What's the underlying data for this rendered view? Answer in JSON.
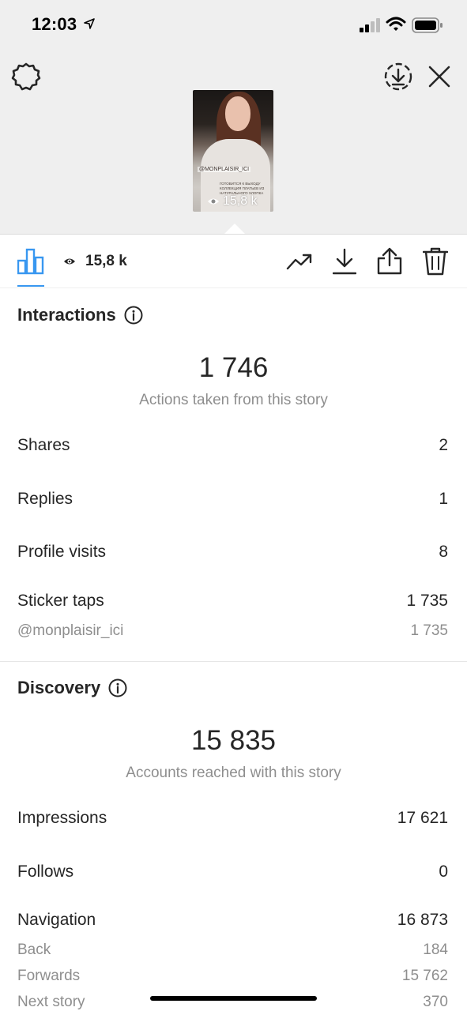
{
  "status_bar": {
    "time": "12:03"
  },
  "story_thumbnail": {
    "handle_text": "@MONPLAISIR_ICI",
    "caption_text": "ГОТОВИТСЯ К ВЫХОДУ КОЛЛЕКЦИЯ ПЛАТЬЕВ ИЗ НАТУРАЛЬНОГО ХЛОПКА",
    "views": "15,8 k"
  },
  "toolbar": {
    "views": "15,8 k"
  },
  "interactions": {
    "title": "Interactions",
    "total": "1 746",
    "caption": "Actions taken from this story",
    "rows": [
      {
        "label": "Shares",
        "value": "2"
      },
      {
        "label": "Replies",
        "value": "1"
      },
      {
        "label": "Profile visits",
        "value": "8"
      },
      {
        "label": "Sticker taps",
        "value": "1 735"
      }
    ],
    "sticker_sub": {
      "label": "@monplaisir_ici",
      "value": "1 735"
    }
  },
  "discovery": {
    "title": "Discovery",
    "total": "15 835",
    "caption": "Accounts reached with this story",
    "rows": [
      {
        "label": "Impressions",
        "value": "17 621"
      },
      {
        "label": "Follows",
        "value": "0"
      },
      {
        "label": "Navigation",
        "value": "16 873"
      }
    ],
    "navigation_sub": [
      {
        "label": "Back",
        "value": "184"
      },
      {
        "label": "Forwards",
        "value": "15 762"
      },
      {
        "label": "Next story",
        "value": "370"
      }
    ]
  },
  "colors": {
    "accent": "#3897f0",
    "muted_text": "#8e8e8e",
    "header_bg": "#efefef"
  }
}
